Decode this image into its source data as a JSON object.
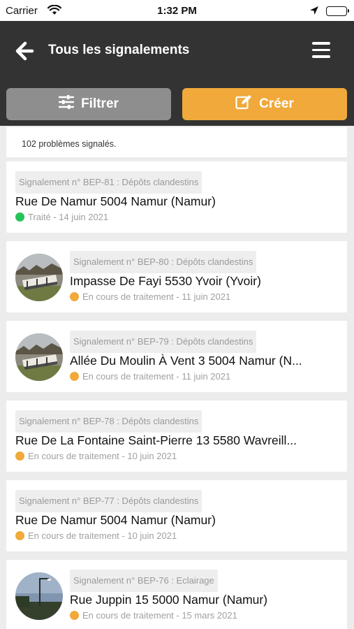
{
  "status_bar": {
    "carrier": "Carrier",
    "time": "1:32 PM"
  },
  "header": {
    "title": "Tous les signalements"
  },
  "actions": {
    "filter_label": "Filtrer",
    "create_label": "Créer"
  },
  "count_text": "102 problèmes signalés.",
  "colors": {
    "header_bg": "#333333",
    "filter_bg": "#8e8e8e",
    "create_bg": "#f0a93a",
    "treated": "#27c35a",
    "in_progress": "#f0a93a"
  },
  "reports": [
    {
      "tag": "Signalement n° BEP-81 : Dépôts clandestins",
      "address": "Rue De Namur 5004 Namur (Namur)",
      "status": "Traité - 14 juin 2021",
      "status_type": "treated",
      "has_image": false
    },
    {
      "tag": "Signalement n° BEP-80 : Dépôts clandestins",
      "address": "Impasse De Fayi 5530 Yvoir (Yvoir)",
      "status": "En cours de traitement - 11 juin 2021",
      "status_type": "in_progress",
      "has_image": true
    },
    {
      "tag": "Signalement n° BEP-79 : Dépôts clandestins",
      "address": "Allée Du Moulin À Vent 3 5004 Namur (N...",
      "status": "En cours de traitement - 11 juin 2021",
      "status_type": "in_progress",
      "has_image": true
    },
    {
      "tag": "Signalement n° BEP-78 : Dépôts clandestins",
      "address": "Rue De La Fontaine Saint-Pierre 13 5580 Wavreill...",
      "status": "En cours de traitement - 10 juin 2021",
      "status_type": "in_progress",
      "has_image": false
    },
    {
      "tag": "Signalement n° BEP-77 : Dépôts clandestins",
      "address": "Rue De Namur 5004 Namur (Namur)",
      "status": "En cours de traitement - 10 juin 2021",
      "status_type": "in_progress",
      "has_image": false
    },
    {
      "tag": "Signalement n° BEP-76 : Eclairage",
      "address": "Rue Juppin 15 5000 Namur (Namur)",
      "status": "En cours de traitement - 15 mars 2021",
      "status_type": "in_progress",
      "has_image": true
    }
  ]
}
